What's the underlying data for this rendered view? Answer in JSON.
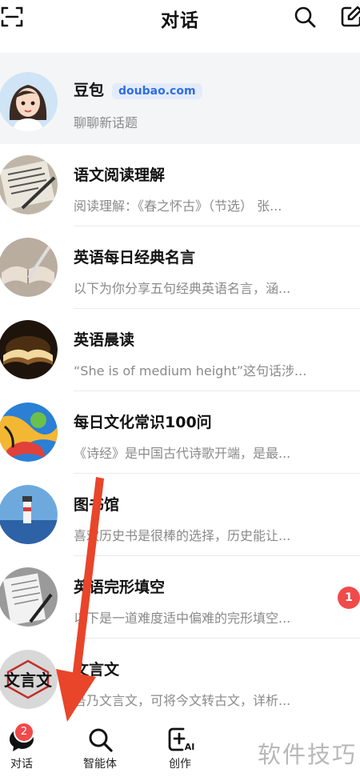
{
  "header": {
    "title": "对话"
  },
  "pinned": {
    "name": "豆包",
    "badge": "doubao.com",
    "preview": "聊聊新话题"
  },
  "chats": [
    {
      "name": "语文阅读理解",
      "preview": "阅读理解：《春之怀古》（节选） 张..."
    },
    {
      "name": "英语每日经典名言",
      "preview": "以下为你分享五句经典英语名言，涵..."
    },
    {
      "name": "英语晨读",
      "preview": "“She is of medium height”这句话涉..."
    },
    {
      "name": "每日文化常识100问",
      "preview": "《诗经》是中国古代诗歌开端，是最..."
    },
    {
      "name": "图书馆",
      "preview": "喜欢历史书是很棒的选择，历史能让..."
    },
    {
      "name": "英语完形填空",
      "preview": "以下是一道难度适中偏难的完形填空...",
      "unread": "1"
    },
    {
      "name": "文言文",
      "preview": "吾乃文言文，可将今文转古文，详析...",
      "avatar_text": "文言文"
    }
  ],
  "nav": {
    "chat_label": "对话",
    "chat_badge": "2",
    "agents_label": "智能体",
    "create_label": "创作",
    "create_icon_text": "AI"
  },
  "watermark": "软件技巧",
  "colors": {
    "badge_red": "#f04b4b",
    "arrow": "#e8452a",
    "link_blue": "#2e6fe0"
  }
}
